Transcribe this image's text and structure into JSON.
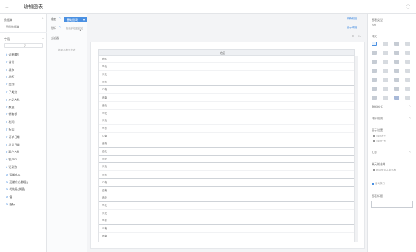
{
  "header": {
    "title": "编辑图表",
    "back_icon": "arrow-left-icon",
    "expand_icon": "fullscreen-icon"
  },
  "left": {
    "dataset_label": "数据集",
    "dataset_name": "示例数据集",
    "fields_label": "字段",
    "search_placeholder": "",
    "fields": [
      "订单编号",
      "省份",
      "城市",
      "地区",
      "类别",
      "子类别",
      "产品名称",
      "数量",
      "销售额",
      "利润",
      "折扣",
      "订单日期",
      "发货日期",
      "客户名称",
      "客户ID",
      "记录数",
      "运输成本",
      "运输方式(数量)",
      "优先级(数量)",
      "值",
      "指标"
    ]
  },
  "mid": {
    "dimension_label": "维度",
    "metric_label": "指标",
    "filter_label": "过滤器",
    "placeholder_drag": "拖动字段至此处",
    "tab_active": "基础图表"
  },
  "canvas": {
    "table_header": "地区",
    "top_right_links": [
      "刷新视图",
      "显示明细"
    ],
    "rows": [
      "地区",
      "华北",
      "东北",
      "华东",
      "中南",
      "西南",
      "西北",
      "华北",
      "东北",
      "华东",
      "中南",
      "西南",
      "西北",
      "华北",
      "东北",
      "华东",
      "中南",
      "西南",
      "西北",
      "华北",
      "东北",
      "华东",
      "中南",
      "西南"
    ]
  },
  "right": {
    "chart_type_label": "图表类型",
    "chart_type_value": "表格",
    "style_label": "样式",
    "axis_label": "数据格式",
    "sort_label": "排序规则",
    "show_label": "显示设置",
    "opt1": "显示表头",
    "opt2": "显示行号",
    "totals_label": "汇总",
    "merge_label": "单元格合并",
    "merge_opt": "相同值合并单元格",
    "auto_label": "自动换行",
    "title_label": "图表标题"
  },
  "colors": {
    "accent": "#4a90e2",
    "border": "#e3e5e8"
  }
}
